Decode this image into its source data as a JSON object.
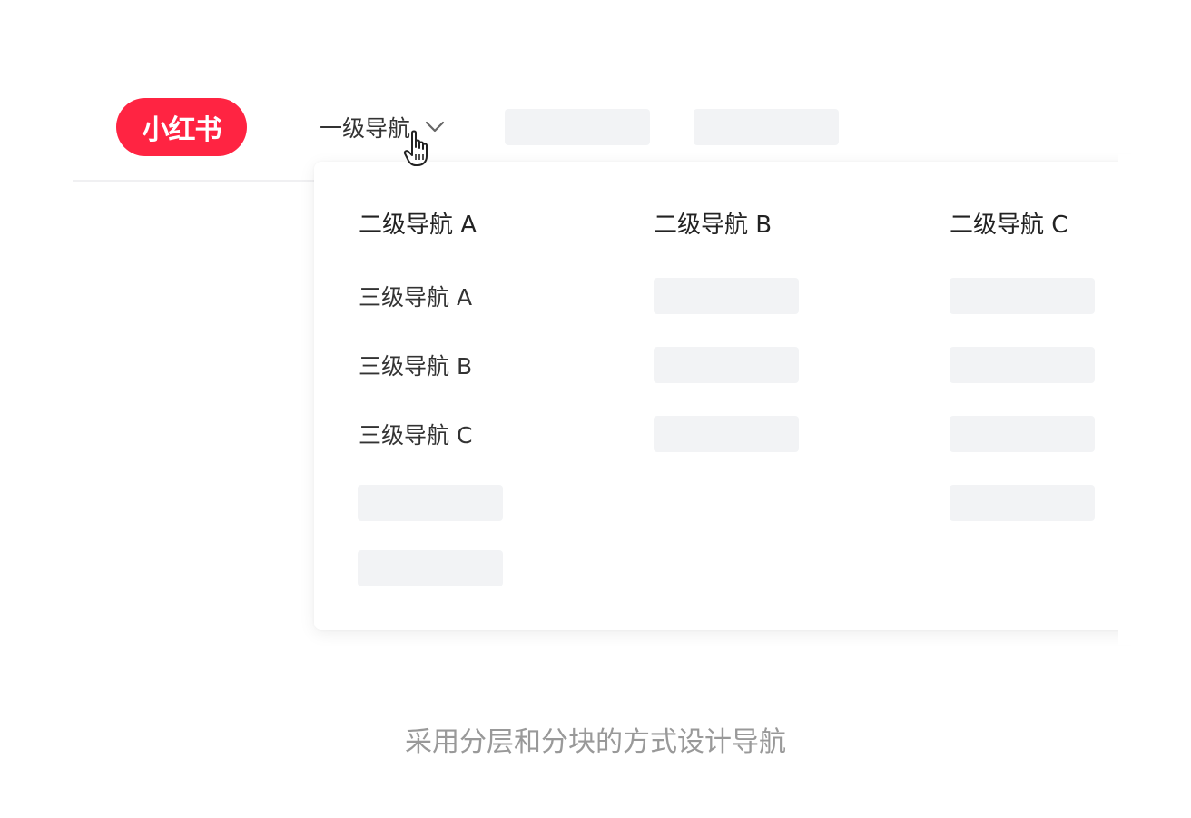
{
  "logo": {
    "text": "小红书"
  },
  "header": {
    "primary_nav_label": "一级导航"
  },
  "dropdown": {
    "columns": [
      {
        "title": "二级导航 A",
        "items": [
          "三级导航 A",
          "三级导航 B",
          "三级导航 C"
        ]
      },
      {
        "title": "二级导航 B"
      },
      {
        "title": "二级导航 C"
      }
    ]
  },
  "caption": "采用分层和分块的方式设计导航",
  "colors": {
    "brand": "#ff2442",
    "placeholder": "#f2f3f5",
    "caption_text": "#999999"
  },
  "icons": {
    "dropdown_indicator": "chevron-down-icon",
    "pointer": "hand-pointer-icon"
  }
}
